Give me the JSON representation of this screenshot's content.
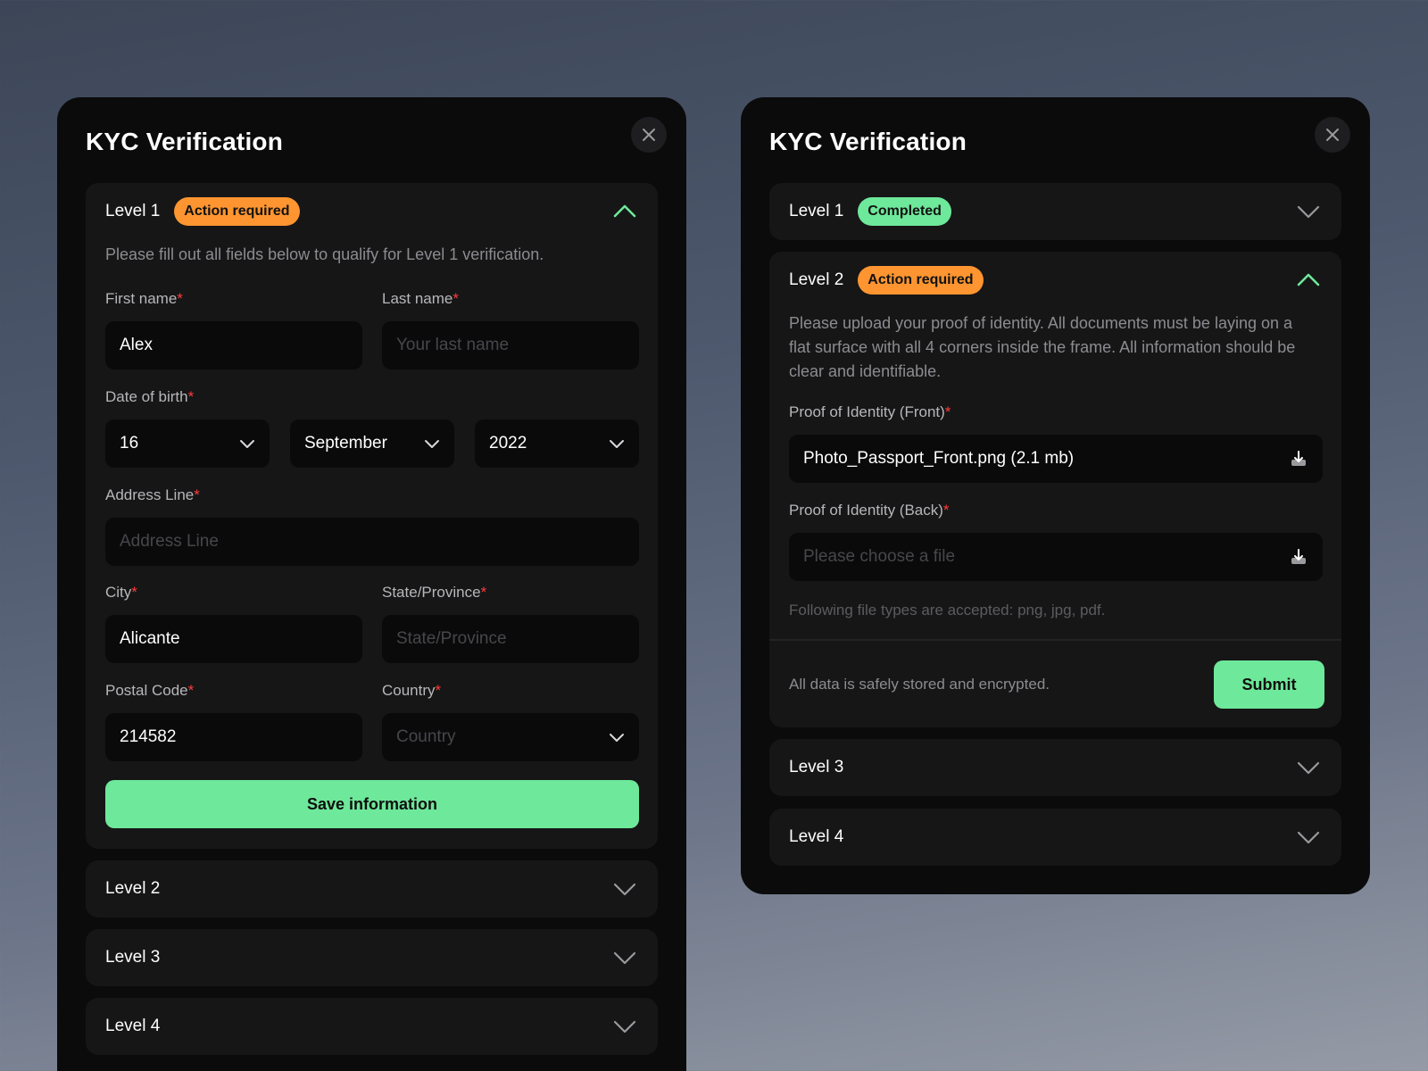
{
  "colors": {
    "accent_green": "#6ee89a",
    "badge_orange": "#ff9530",
    "required_red": "#ff3b3b",
    "modal_bg": "#0b0b0c",
    "panel_bg": "#161617"
  },
  "left_modal": {
    "title": "KYC Verification",
    "close_icon": "close-icon",
    "level1": {
      "title": "Level 1",
      "badge": "Action required",
      "expanded": true,
      "description": "Please fill out all fields below to qualify for Level 1 verification.",
      "first_name": {
        "label": "First name",
        "value": "Alex"
      },
      "last_name": {
        "label": "Last name",
        "placeholder": "Your last name"
      },
      "dob": {
        "label": "Date of birth",
        "day": "16",
        "month": "September",
        "year": "2022"
      },
      "address": {
        "label": "Address Line",
        "placeholder": "Address Line"
      },
      "city": {
        "label": "City",
        "value": "Alicante"
      },
      "state": {
        "label": "State/Province",
        "placeholder": "State/Province"
      },
      "postal": {
        "label": "Postal Code",
        "value": "214582"
      },
      "country": {
        "label": "Country",
        "placeholder": "Country"
      },
      "save_button": "Save information"
    },
    "level2": {
      "title": "Level 2"
    },
    "level3": {
      "title": "Level 3"
    },
    "level4": {
      "title": "Level 4"
    }
  },
  "right_modal": {
    "title": "KYC Verification",
    "close_icon": "close-icon",
    "level1": {
      "title": "Level 1",
      "badge": "Completed"
    },
    "level2": {
      "title": "Level 2",
      "badge": "Action required",
      "expanded": true,
      "description": "Please upload your proof of identity. All documents must be laying on a flat surface with all 4 corners inside the frame. All information should be clear and identifiable.",
      "front": {
        "label": "Proof of Identity (Front)",
        "value": "Photo_Passport_Front.png (2.1 mb)"
      },
      "back": {
        "label": "Proof of Identity (Back)",
        "placeholder": "Please choose a file"
      },
      "accepted_types": "Following file types are accepted: png, jpg, pdf.",
      "security_note": "All data is safely stored and encrypted.",
      "submit_button": "Submit"
    },
    "level3": {
      "title": "Level 3"
    },
    "level4": {
      "title": "Level 4"
    }
  },
  "required_mark": "*"
}
